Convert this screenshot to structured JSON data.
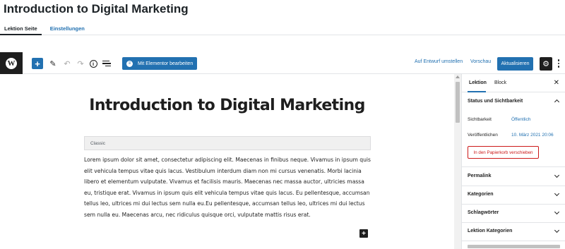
{
  "page": {
    "title": "Introduction to Digital Marketing",
    "tabs": [
      {
        "label": "Lektion Seite",
        "active": true
      },
      {
        "label": "Einstellungen",
        "active": false
      }
    ]
  },
  "toolbar": {
    "logo_icon": "wordpress-icon",
    "logo_glyph": "W",
    "add_block_icon": "plus-icon",
    "tools_icon": "pencil-icon",
    "undo_icon": "undo-icon",
    "redo_icon": "redo-icon",
    "details_icon": "info-icon",
    "outline_icon": "list-view-icon",
    "elementor_label": "Mit Elementor bearbeiten",
    "elementor_icon": "elementor-icon",
    "switch_to_draft_label": "Auf Entwurf umstellen",
    "preview_label": "Vorschau",
    "update_label": "Aktualisieren",
    "settings_icon": "gear-icon",
    "more_icon": "more-vertical-icon"
  },
  "editor": {
    "post_title": "Introduction to Digital Marketing",
    "classic_block_label": "Classic",
    "content": "Lorem ipsum dolor sit amet, consectetur adipiscing elit. Maecenas in finibus neque. Vivamus in ipsum quis elit vehicula tempus vitae quis lacus. Vestibulum interdum diam non mi cursus venenatis. Morbi lacinia libero et elementum vulputate. Vivamus et facilisis mauris. Maecenas nec massa auctor, ultricies massa eu, tristique erat. Vivamus in ipsum quis elit vehicula tempus vitae quis lacus. Eu pellentesque, accumsan tellus leo, ultrices mi dui lectus sem nulla eu.Eu pellentesque, accumsan tellus leo, ultrices mi dui lectus sem nulla eu. Maecenas arcu, nec ridiculus quisque orci, vulputate mattis risus erat.",
    "inserter_icon": "plus-icon"
  },
  "sidebar": {
    "tabs": [
      {
        "label": "Lektion",
        "active": true
      },
      {
        "label": "Block",
        "active": false
      }
    ],
    "close_icon": "close-icon",
    "status_panel": {
      "title": "Status und Sichtbarkeit",
      "expanded": true,
      "visibility_label": "Sichtbarkeit",
      "visibility_value": "Öffentlich",
      "published_label": "Veröffentlichen",
      "published_value": "10. März 2021 20:06",
      "trash_label": "In den Papierkorb verschieben"
    },
    "panels": [
      {
        "title": "Permalink"
      },
      {
        "title": "Kategorien"
      },
      {
        "title": "Schlagwörter"
      },
      {
        "title": "Lektion Kategorien"
      }
    ]
  }
}
